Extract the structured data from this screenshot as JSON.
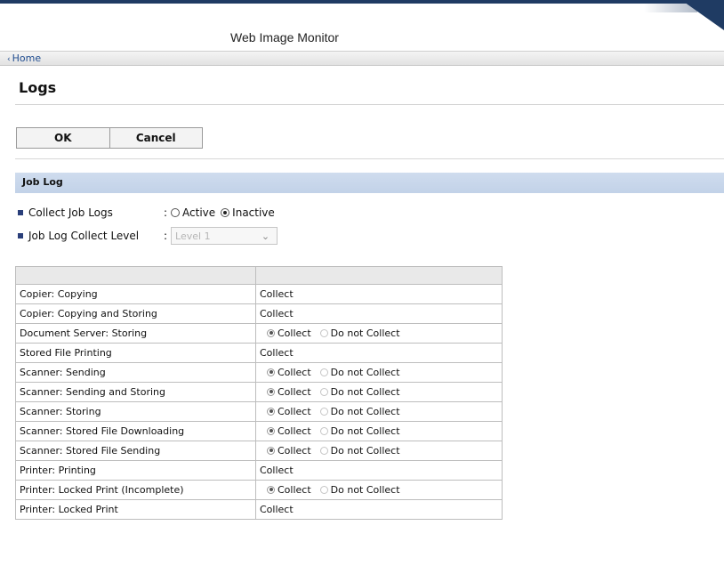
{
  "header": {
    "app_title": "Web Image Monitor"
  },
  "breadcrumb": {
    "home": "Home"
  },
  "page": {
    "title": "Logs"
  },
  "buttons": {
    "ok": "OK",
    "cancel": "Cancel"
  },
  "section": {
    "title": "Job Log"
  },
  "settings": {
    "collect_job_logs": {
      "label": "Collect Job Logs",
      "options": [
        {
          "label": "Active",
          "selected": false
        },
        {
          "label": "Inactive",
          "selected": true
        }
      ]
    },
    "collect_level": {
      "label": "Job Log Collect Level",
      "value": "Level 1",
      "disabled": true
    }
  },
  "table": {
    "headers": [
      "",
      ""
    ],
    "rows": [
      {
        "name": "Copier: Copying",
        "value": "Collect",
        "selectable": false
      },
      {
        "name": "Copier: Copying and Storing",
        "value": "Collect",
        "selectable": false
      },
      {
        "name": "Document Server: Storing",
        "options": [
          "Collect",
          "Do not Collect"
        ],
        "selectable": true
      },
      {
        "name": "Stored File Printing",
        "value": "Collect",
        "selectable": false
      },
      {
        "name": "Scanner: Sending",
        "options": [
          "Collect",
          "Do not Collect"
        ],
        "selectable": true
      },
      {
        "name": "Scanner: Sending and Storing",
        "options": [
          "Collect",
          "Do not Collect"
        ],
        "selectable": true
      },
      {
        "name": "Scanner: Storing",
        "options": [
          "Collect",
          "Do not Collect"
        ],
        "selectable": true
      },
      {
        "name": "Scanner: Stored File Downloading",
        "options": [
          "Collect",
          "Do not Collect"
        ],
        "selectable": true
      },
      {
        "name": "Scanner: Stored File Sending",
        "options": [
          "Collect",
          "Do not Collect"
        ],
        "selectable": true
      },
      {
        "name": "Printer: Printing",
        "value": "Collect",
        "selectable": false
      },
      {
        "name": "Printer: Locked Print (Incomplete)",
        "options": [
          "Collect",
          "Do not Collect"
        ],
        "selectable": true
      },
      {
        "name": "Printer: Locked Print",
        "value": "Collect",
        "selectable": false
      }
    ]
  },
  "colors": {
    "accent_dark": "#1f3b63",
    "section_bar": "#c7d6ea",
    "link": "#1f4c8f"
  }
}
